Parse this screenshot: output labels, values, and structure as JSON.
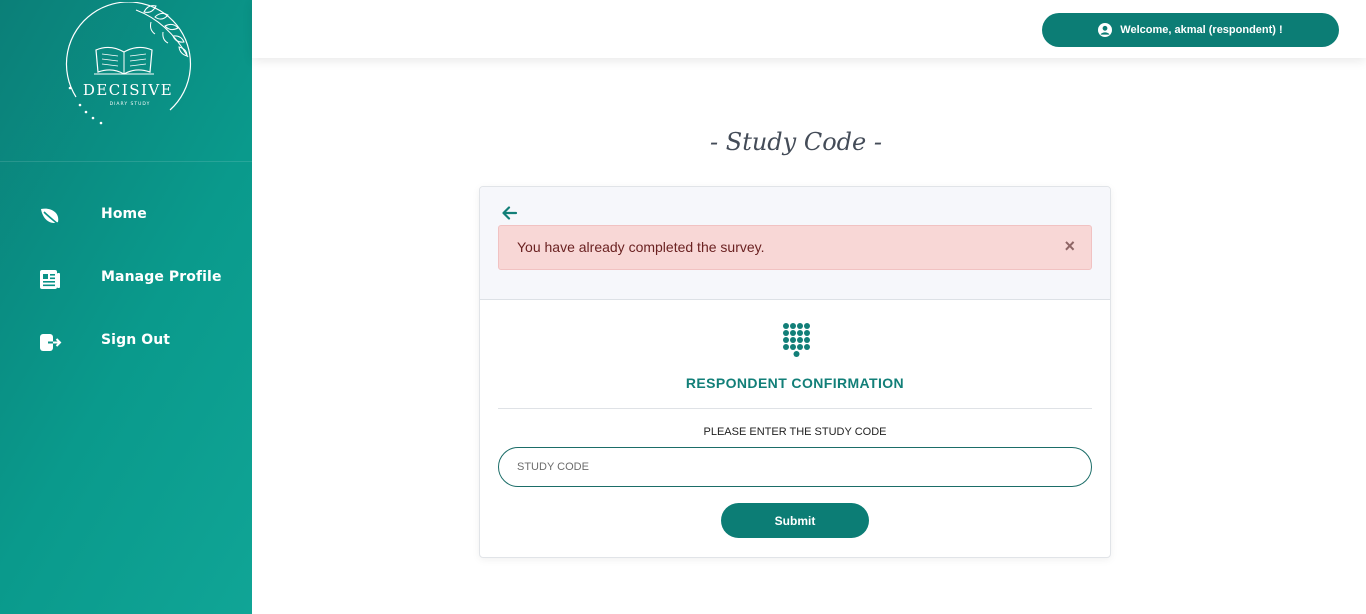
{
  "brand": {
    "name": "DECISIVE",
    "tagline": "DIARY STUDY"
  },
  "sidebar": {
    "items": [
      {
        "label": "Home",
        "icon": "leaf-icon"
      },
      {
        "label": "Manage Profile",
        "icon": "profile-document-icon"
      },
      {
        "label": "Sign Out",
        "icon": "sign-out-icon"
      }
    ]
  },
  "header": {
    "welcome": "Welcome, akmal (respondent) !",
    "icon": "user-circle-icon"
  },
  "page": {
    "title": "- Study Code -"
  },
  "card": {
    "back_icon": "arrow-left-icon",
    "alert": {
      "message": "You have already completed the survey.",
      "close": "×"
    },
    "section_icon": "dialpad-icon",
    "section_title": "RESPONDENT CONFIRMATION",
    "prompt": "PLEASE ENTER THE STUDY CODE",
    "input": {
      "value": "",
      "placeholder": "STUDY CODE"
    },
    "submit_label": "Submit"
  },
  "colors": {
    "primary": "#0c7d75",
    "sidebar_start": "#0b7f78",
    "sidebar_end": "#10a596",
    "alert_bg": "#f8d7d6",
    "alert_text": "#6b2222"
  }
}
